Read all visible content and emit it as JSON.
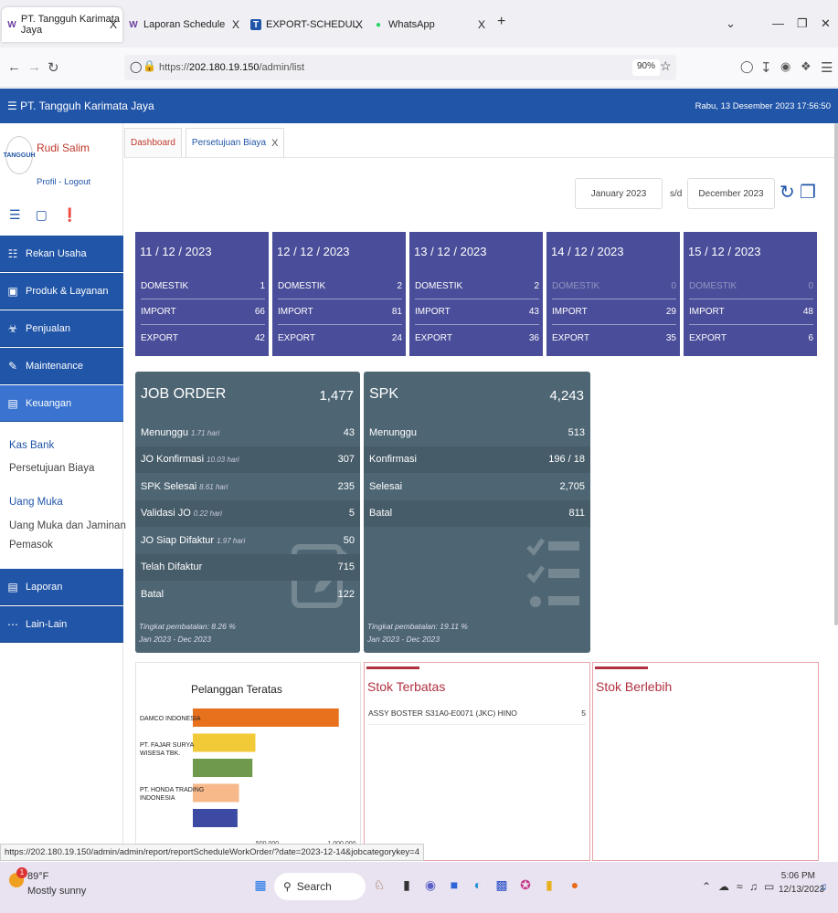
{
  "browser": {
    "tabs": [
      {
        "label": "PT. Tangguh Karimata Jaya",
        "favicon": "W",
        "close": "X"
      },
      {
        "label": "Laporan Schedule",
        "favicon": "W",
        "close": "X"
      },
      {
        "label": "EXPORT-SCHEDULE TOMORRO",
        "favicon": "T",
        "close": "X"
      },
      {
        "label": "WhatsApp",
        "favicon": "●",
        "close": "X"
      }
    ],
    "new_tab": "+",
    "url_prefix": "https://",
    "url_host": "202.180.19.150",
    "url_path": "/admin/list",
    "zoom": "90%",
    "status_url": "https://202.180.19.150/admin/admin/report/reportScheduleWorkOrder/?date=2023-12-14&jobcategorykey=4"
  },
  "app": {
    "brand": "PT. Tangguh Karimata Jaya",
    "datetime": "Rabu, 13 Desember 2023  17:56:50",
    "accent": "#2155a8"
  },
  "user": {
    "logo_text": "TANGGUH",
    "name": "Rudi Salim",
    "links": "Profil - Logout"
  },
  "sidebar": {
    "menu": [
      {
        "label": "Rekan Usaha",
        "icon": "people-icon"
      },
      {
        "label": "Produk & Layanan",
        "icon": "box-icon"
      },
      {
        "label": "Penjualan",
        "icon": "cart-icon"
      },
      {
        "label": "Maintenance",
        "icon": "wrench-icon"
      },
      {
        "label": "Keuangan",
        "icon": "money-icon"
      }
    ],
    "sub": {
      "kas_bank": "Kas Bank",
      "persetujuan": "Persetujuan Biaya",
      "uang_muka": "Uang Muka",
      "uang_muka_jaminan_1": "Uang Muka dan Jaminan",
      "uang_muka_jaminan_2": "Pemasok"
    },
    "menu2": [
      {
        "label": "Laporan",
        "icon": "clipboard-icon"
      },
      {
        "label": "Lain-Lain",
        "icon": "dots-icon"
      }
    ]
  },
  "content_tabs": {
    "dashboard": "Dashboard",
    "current": "Persetujuan Biaya",
    "close": "X"
  },
  "filters": {
    "from": "January 2023",
    "sep": "s/d",
    "to": "December 2023"
  },
  "days": [
    {
      "date": "11 / 12 / 2023",
      "rows": [
        {
          "label": "DOMESTIK",
          "value": "1"
        },
        {
          "label": "IMPORT",
          "value": "66"
        },
        {
          "label": "EXPORT",
          "value": "42"
        }
      ],
      "dim_domestik": false
    },
    {
      "date": "12 / 12 / 2023",
      "rows": [
        {
          "label": "DOMESTIK",
          "value": "2"
        },
        {
          "label": "IMPORT",
          "value": "81"
        },
        {
          "label": "EXPORT",
          "value": "24"
        }
      ],
      "dim_domestik": false
    },
    {
      "date": "13 / 12 / 2023",
      "rows": [
        {
          "label": "DOMESTIK",
          "value": "2"
        },
        {
          "label": "IMPORT",
          "value": "43"
        },
        {
          "label": "EXPORT",
          "value": "36"
        }
      ],
      "dim_domestik": false
    },
    {
      "date": "14 / 12 / 2023",
      "rows": [
        {
          "label": "DOMESTIK",
          "value": "0"
        },
        {
          "label": "IMPORT",
          "value": "29"
        },
        {
          "label": "EXPORT",
          "value": "35"
        }
      ],
      "dim_domestik": true
    },
    {
      "date": "15 / 12 / 2023",
      "rows": [
        {
          "label": "DOMESTIK",
          "value": "0"
        },
        {
          "label": "IMPORT",
          "value": "48"
        },
        {
          "label": "EXPORT",
          "value": "6"
        }
      ],
      "dim_domestik": true
    }
  ],
  "job_order": {
    "title": "JOB ORDER",
    "total": "1,477",
    "rows": [
      {
        "label": "Menunggu",
        "note": "1.71 hari",
        "value": "43"
      },
      {
        "label": "JO Konfirmasi",
        "note": "10.03 hari",
        "value": "307"
      },
      {
        "label": "SPK Selesai",
        "note": "8.61 hari",
        "value": "235"
      },
      {
        "label": "Validasi JO",
        "note": "0.22 hari",
        "value": "5"
      },
      {
        "label": "JO Siap Difaktur",
        "note": "1.97 hari",
        "value": "50"
      },
      {
        "label": "Telah Difaktur",
        "note": "",
        "value": "715"
      },
      {
        "label": "Batal",
        "note": "",
        "value": "122"
      }
    ],
    "foot1": "Tingkat pembatalan: 8.26 %",
    "foot2": "Jan 2023 - Dec 2023"
  },
  "spk": {
    "title": "SPK",
    "total": "4,243",
    "rows": [
      {
        "label": "Menunggu",
        "value": "513"
      },
      {
        "label": "Konfirmasi",
        "value": "196 / 18"
      },
      {
        "label": "Selesai",
        "value": "2,705"
      },
      {
        "label": "Batal",
        "value": "811"
      }
    ],
    "foot1": "Tingkat pembatalan: 19.11 %",
    "foot2": "Jan 2023 - Dec 2023"
  },
  "chart_data": {
    "type": "bar",
    "orientation": "horizontal",
    "title": "Pelanggan Teratas",
    "categories": [
      "DAMCO INDONESIA",
      "PT. FAJAR SURYA WISESA TBK.",
      "",
      "PT. HONDA TRADING INDONESIA",
      ""
    ],
    "values": [
      980000,
      420000,
      400000,
      310000,
      300000
    ],
    "colors": [
      "#e8711e",
      "#f2c936",
      "#6f9a4b",
      "#f7b98a",
      "#3c4aa3"
    ],
    "xlim": [
      0,
      1000000
    ],
    "xticks": [
      "",
      "500,000",
      "1,000,000"
    ]
  },
  "stok_terbatas": {
    "title": "Stok Terbatas",
    "items": [
      {
        "name": "ASSY BOSTER S31A0-E0071 (JKC) HINO",
        "qty": "5"
      }
    ]
  },
  "stok_berlebih": {
    "title": "Stok Berlebih"
  },
  "taskbar": {
    "weather_temp": "89°F",
    "weather_desc": "Mostly sunny",
    "weather_badge": "1",
    "search": "Search",
    "time": "5:06 PM",
    "date": "12/13/2023"
  }
}
